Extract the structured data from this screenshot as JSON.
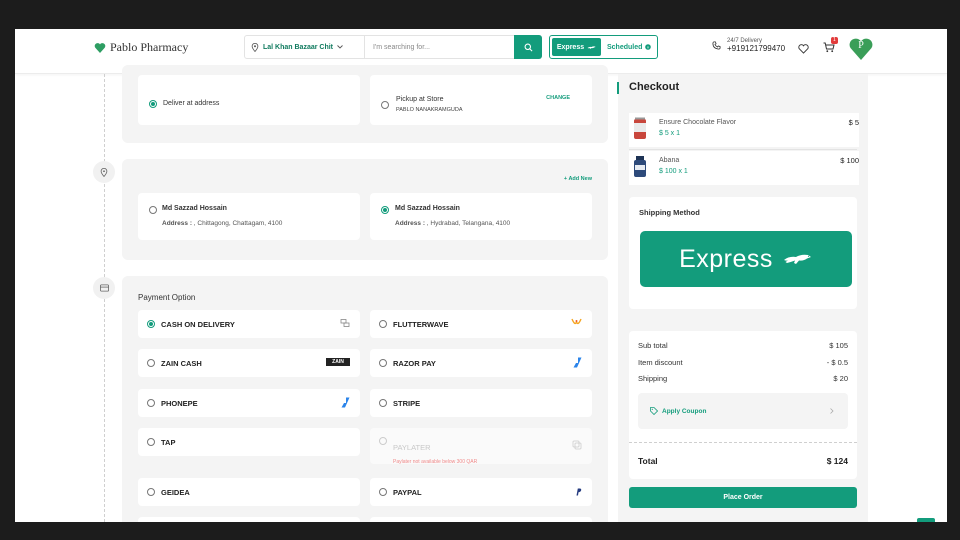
{
  "header": {
    "logo_text": "Pablo Pharmacy",
    "location": "Lal Khan Bazaar Chit",
    "search_placeholder": "I'm searching for...",
    "delivery_modes": [
      "Express",
      "Scheduled"
    ],
    "support_label": "24/7 Delivery",
    "support_phone": "+919121799470",
    "cart_count": "1",
    "avatar_initial": "P"
  },
  "delivery_options": {
    "deliver_label": "Deliver at address",
    "pickup_label": "Pickup at Store",
    "pickup_store": "PABLO NANAKRAMGUDA",
    "change_label": "CHANGE",
    "selected": "Deliver at address"
  },
  "addresses": {
    "add_new_label": "+ Add New",
    "items": [
      {
        "name": "Md Sazzad Hossain",
        "address_label": "Address :",
        "address": " , Chittagong, Chattagam, 4100",
        "selected": false
      },
      {
        "name": "Md Sazzad Hossain",
        "address_label": "Address :",
        "address": " , Hydrabad, Telangana, 4100",
        "selected": true
      }
    ]
  },
  "payment": {
    "title": "Payment Option",
    "options": [
      {
        "name": "CASH ON DELIVERY",
        "selected": true
      },
      {
        "name": "FLUTTERWAVE",
        "selected": false
      },
      {
        "name": "ZAIN CASH",
        "selected": false
      },
      {
        "name": "RAZOR PAY",
        "selected": false
      },
      {
        "name": "PHONEPE",
        "selected": false
      },
      {
        "name": "STRIPE",
        "selected": false
      },
      {
        "name": "TAP",
        "selected": false
      },
      {
        "name": "PAYLATER",
        "selected": false,
        "disabled": true,
        "note": "Paylater not available below 300 QAR"
      },
      {
        "name": "GEIDEA",
        "selected": false
      },
      {
        "name": "PAYPAL",
        "selected": false
      }
    ],
    "zain_logo_text": "ZAIN"
  },
  "checkout": {
    "title": "Checkout",
    "items": [
      {
        "name": "Ensure Chocolate Flavor",
        "qty": "$ 5 x 1",
        "price": "$ 5"
      },
      {
        "name": "Abana",
        "qty": "$ 100 x 1",
        "price": "$ 100"
      }
    ],
    "shipping_method_label": "Shipping Method",
    "shipping_method": "Express",
    "subtotal_label": "Sub total",
    "subtotal": "$ 105",
    "discount_label": "Item discount",
    "discount": "- $ 0.5",
    "shipping_label": "Shipping",
    "shipping": "$ 20",
    "coupon_label": "Apply Coupon",
    "total_label": "Total",
    "total": "$ 124",
    "place_order_label": "Place Order"
  },
  "colors": {
    "brand": "#139c7c",
    "panel": "#f4f4f4",
    "badge": "#e23b3b"
  }
}
